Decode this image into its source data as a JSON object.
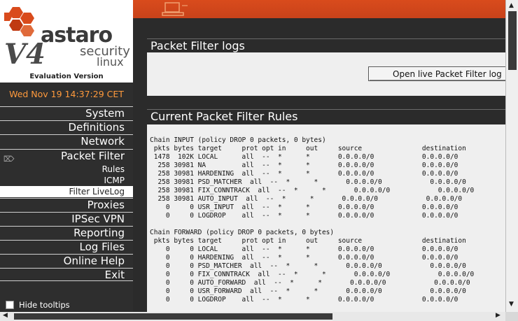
{
  "brand": {
    "name": "astaro",
    "version": "V4",
    "product_line1": "security",
    "product_line2": "linux",
    "edition": "Evaluation Version"
  },
  "datetime": "Wed Nov 19 14:37:29 CET",
  "nav": [
    {
      "label": "System"
    },
    {
      "label": "Definitions"
    },
    {
      "label": "Network"
    },
    {
      "label": "Packet Filter"
    },
    {
      "label": "Proxies"
    },
    {
      "label": "IPSec VPN"
    },
    {
      "label": "Reporting"
    },
    {
      "label": "Log Files"
    },
    {
      "label": "Online Help"
    },
    {
      "label": "Exit"
    }
  ],
  "subnav": [
    {
      "label": "Rules"
    },
    {
      "label": "ICMP"
    },
    {
      "label": "Filter LiveLog"
    }
  ],
  "hide_tooltips_label": "Hide tooltips",
  "logs_panel": {
    "title": "Packet Filter logs",
    "button_label": "Open live Packet Filter log"
  },
  "rules_panel": {
    "title": "Current Packet Filter Rules",
    "text": "Chain INPUT (policy DROP 0 packets, 0 bytes)\n pkts bytes target     prot opt in     out     source               destination\n 1478  102K LOCAL      all  --  *      *       0.0.0.0/0            0.0.0.0/0\n  258 30981 NA         all  --  *      *       0.0.0.0/0            0.0.0.0/0\n  258 30981 HARDENING  all  --  *      *       0.0.0.0/0            0.0.0.0/0\n  258 30981 PSD_MATCHER  all  --  *      *       0.0.0.0/0            0.0.0.0/0\n  258 30981 FIX_CONNTRACK  all  --  *      *       0.0.0.0/0            0.0.0.0/0\n  258 30981 AUTO_INPUT  all  --  *      *       0.0.0.0/0            0.0.0.0/0\n    0     0 USR_INPUT  all  --  *      *       0.0.0.0/0            0.0.0.0/0\n    0     0 LOGDROP    all  --  *      *       0.0.0.0/0            0.0.0.0/0\n\nChain FORWARD (policy DROP 0 packets, 0 bytes)\n pkts bytes target     prot opt in     out     source               destination\n    0     0 LOCAL      all  --  *      *       0.0.0.0/0            0.0.0.0/0\n    0     0 HARDENING  all  --  *      *       0.0.0.0/0            0.0.0.0/0\n    0     0 PSD_MATCHER  all  --  *      *       0.0.0.0/0            0.0.0.0/0\n    0     0 FIX_CONNTRACK  all  --  *      *       0.0.0.0/0            0.0.0.0/0\n    0     0 AUTO_FORWARD  all  --  *      *       0.0.0.0/0            0.0.0.0/0\n    0     0 USR_FORWARD  all  --  *      *       0.0.0.0/0            0.0.0.0/0\n    0     0 LOGDROP    all  --  *      *       0.0.0.0/0            0.0.0.0/0"
  },
  "colors": {
    "accent": "#d94b1c",
    "datetime": "#ff9a3c",
    "sidebar_bg": "#2e2e2e",
    "panel_bg": "#efefef"
  },
  "icons": {
    "packet_filter": "packet-filter-icon",
    "topbar": "computer-icon"
  }
}
